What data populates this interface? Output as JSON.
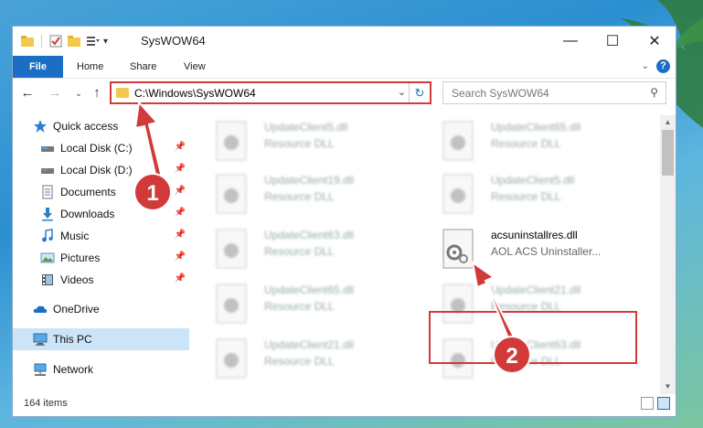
{
  "window": {
    "title": "SysWOW64",
    "controls": {
      "minimize": "—",
      "maximize": "☐",
      "close": "✕"
    }
  },
  "ribbon": {
    "tabs": [
      "File",
      "Home",
      "Share",
      "View"
    ]
  },
  "address": {
    "path": "C:\\Windows\\SysWOW64"
  },
  "search": {
    "placeholder": "Search SysWOW64"
  },
  "nav_pane": {
    "items": [
      {
        "label": "Quick access",
        "icon": "star-icon"
      },
      {
        "label": "Local Disk (C:)",
        "icon": "drive-icon",
        "pinned": true
      },
      {
        "label": "Local Disk (D:)",
        "icon": "drive-icon",
        "pinned": true
      },
      {
        "label": "Documents",
        "icon": "documents-icon",
        "pinned": true
      },
      {
        "label": "Downloads",
        "icon": "downloads-icon",
        "pinned": true
      },
      {
        "label": "Music",
        "icon": "music-icon",
        "pinned": true
      },
      {
        "label": "Pictures",
        "icon": "pictures-icon",
        "pinned": true
      },
      {
        "label": "Videos",
        "icon": "videos-icon",
        "pinned": true
      },
      {
        "label": "OneDrive",
        "icon": "onedrive-icon"
      },
      {
        "label": "This PC",
        "icon": "computer-icon",
        "selected": true
      },
      {
        "label": "Network",
        "icon": "network-icon"
      }
    ]
  },
  "files": [
    {
      "name": "UpdateClient5.dll",
      "type": "Resource DLL"
    },
    {
      "name": "UpdateClient65.dll",
      "type": "Resource DLL"
    },
    {
      "name": "UpdateClient19.dll",
      "type": "Resource DLL"
    },
    {
      "name": "UpdateClient5.dll",
      "type": "Resource DLL"
    },
    {
      "name": "UpdateClient63.dll",
      "type": "Resource DLL"
    },
    {
      "name": "acsuninstallres.dll",
      "type": "AOL ACS Uninstaller...",
      "highlighted": true
    },
    {
      "name": "UpdateClient65.dll",
      "type": "Resource DLL"
    },
    {
      "name": "UpdateClient21.dll",
      "type": "Resource DLL"
    },
    {
      "name": "UpdateClient21.dll",
      "type": "Resource DLL"
    },
    {
      "name": "UpdateClient63.dll",
      "type": "Resource DLL"
    }
  ],
  "status": {
    "item_count": "164 items"
  },
  "annotations": {
    "step1": "1",
    "step2": "2",
    "color": "#d23a3a"
  }
}
